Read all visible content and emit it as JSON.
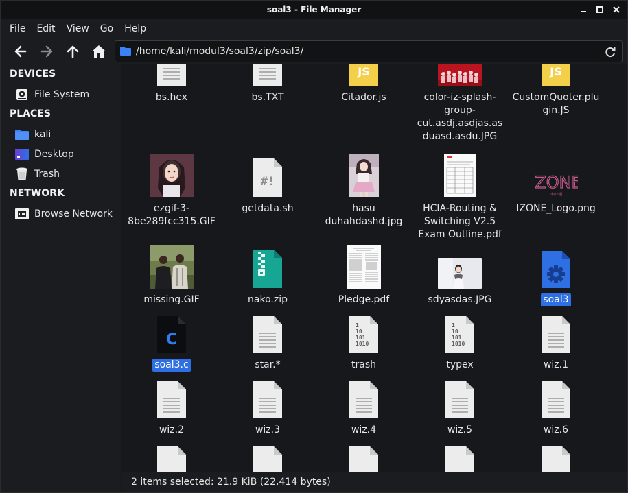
{
  "window": {
    "title": "soal3 - File Manager"
  },
  "menu": [
    "File",
    "Edit",
    "View",
    "Go",
    "Help"
  ],
  "address": {
    "path": "/home/kali/modul3/soal3/zip/soal3/"
  },
  "sidebar": {
    "sections": [
      {
        "title": "DEVICES",
        "items": [
          {
            "label": "File System",
            "icon": "harddisk-icon"
          }
        ]
      },
      {
        "title": "PLACES",
        "items": [
          {
            "label": "kali",
            "icon": "home-folder-icon"
          },
          {
            "label": "Desktop",
            "icon": "desktop-icon"
          },
          {
            "label": "Trash",
            "icon": "trash-icon"
          }
        ]
      },
      {
        "title": "NETWORK",
        "items": [
          {
            "label": "Browse Network",
            "icon": "network-icon"
          }
        ]
      }
    ]
  },
  "files": [
    {
      "name": "bs.hex",
      "icon": "text-file-icon"
    },
    {
      "name": "bs.TXT",
      "icon": "text-file-icon"
    },
    {
      "name": "Citador.js",
      "icon": "javascript-file-icon"
    },
    {
      "name": "color-iz-splash-group-cut.asdj.asdjas.asduasd.asdu.JPG",
      "icon": "image-thumbnail"
    },
    {
      "name": "CustomQuoter.plugin.JS",
      "icon": "javascript-file-icon"
    },
    {
      "name": "ezgif-3-8be289fcc315.GIF",
      "icon": "image-thumbnail"
    },
    {
      "name": "getdata.sh",
      "icon": "shell-script-icon"
    },
    {
      "name": "hasu duhahdashd.jpg",
      "icon": "image-thumbnail"
    },
    {
      "name": "HCIA-Routing & Switching V2.5 Exam Outline.pdf",
      "icon": "pdf-thumbnail"
    },
    {
      "name": "IZONE_Logo.png",
      "icon": "logo-thumbnail"
    },
    {
      "name": "missing.GIF",
      "icon": "image-thumbnail"
    },
    {
      "name": "nako.zip",
      "icon": "zip-archive-icon"
    },
    {
      "name": "Pledge.pdf",
      "icon": "pdf-thumbnail"
    },
    {
      "name": "sdyasdas.JPG",
      "icon": "image-thumbnail"
    },
    {
      "name": "soal3",
      "icon": "executable-gear-icon",
      "selected": true
    },
    {
      "name": "soal3.c",
      "icon": "c-source-icon",
      "selected": true
    },
    {
      "name": "star.*",
      "icon": "text-file-icon"
    },
    {
      "name": "trash",
      "icon": "binary-file-icon"
    },
    {
      "name": "typex",
      "icon": "binary-file-icon"
    },
    {
      "name": "wiz.1",
      "icon": "text-file-icon"
    },
    {
      "name": "wiz.2",
      "icon": "text-file-icon"
    },
    {
      "name": "wiz.3",
      "icon": "text-file-icon"
    },
    {
      "name": "wiz.4",
      "icon": "text-file-icon"
    },
    {
      "name": "wiz.5",
      "icon": "text-file-icon"
    },
    {
      "name": "wiz.6",
      "icon": "text-file-icon"
    }
  ],
  "status": {
    "text": "2 items selected: 21.9 KiB (22,414 bytes)"
  },
  "colors": {
    "selection": "#2f6fe4",
    "folder_blue": "#3b82f6",
    "js_yellow": "#f4cf4a"
  }
}
